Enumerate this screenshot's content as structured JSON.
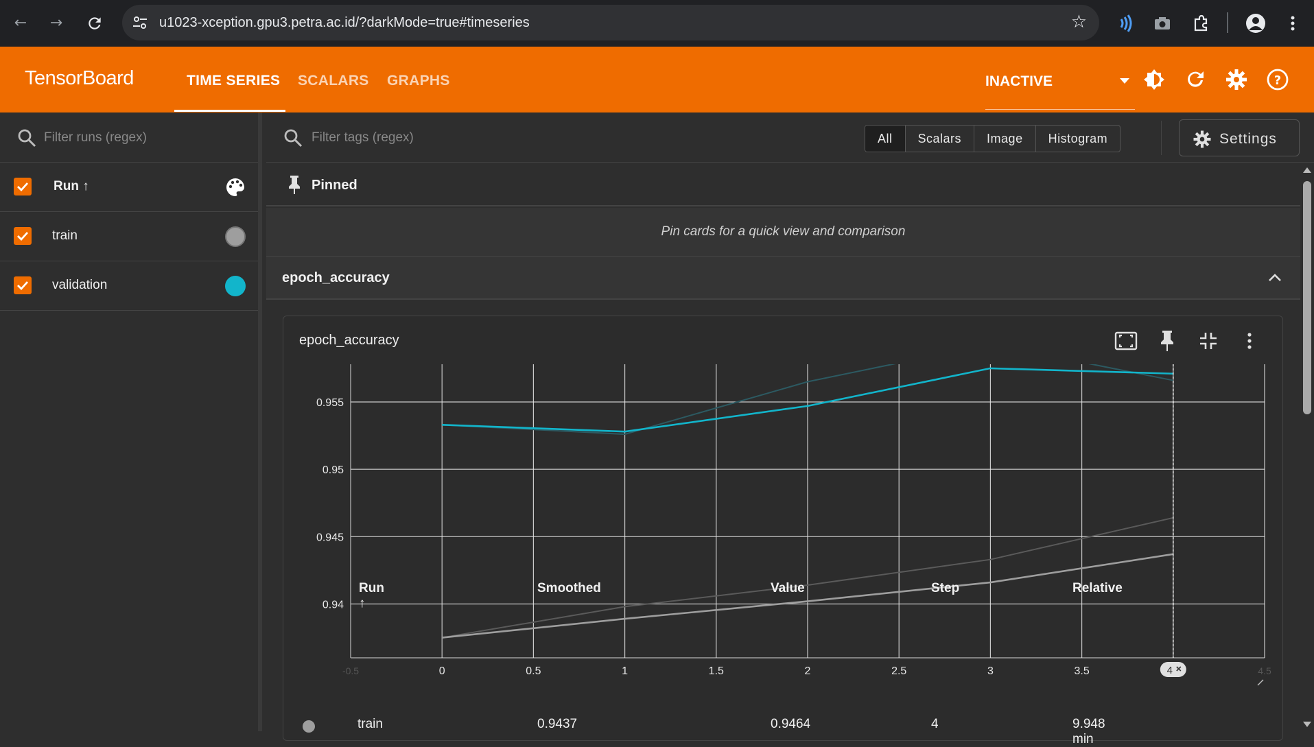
{
  "browser": {
    "url": "u1023-xception.gpu3.petra.ac.id/?darkMode=true#timeseries"
  },
  "header": {
    "brand": "TensorBoard",
    "tabs": [
      {
        "label": "TIME SERIES",
        "active": true
      },
      {
        "label": "SCALARS",
        "active": false
      },
      {
        "label": "GRAPHS",
        "active": false
      }
    ],
    "status": "INACTIVE",
    "accent_color": "#ef6c00"
  },
  "sidebar": {
    "filter_placeholder": "Filter runs (regex)",
    "header_label": "Run ↑",
    "runs": [
      {
        "name": "train",
        "color": "#9e9e9e",
        "checked": true
      },
      {
        "name": "validation",
        "color": "#12b5cb",
        "checked": true
      }
    ]
  },
  "main": {
    "filter_placeholder": "Filter tags (regex)",
    "type_filters": [
      "All",
      "Scalars",
      "Image",
      "Histogram"
    ],
    "settings_label": "Settings",
    "pinned_label": "Pinned",
    "pinned_empty": "Pin cards for a quick view and comparison",
    "group_label": "epoch_accuracy",
    "card_title": "epoch_accuracy",
    "step_marker": "4",
    "edge_tick_left": "-0.5",
    "edge_tick_right": "4.5"
  },
  "chart_data": {
    "type": "line",
    "title": "epoch_accuracy",
    "xlim": [
      -0.5,
      4.5
    ],
    "ylim": [
      0.936,
      0.9578
    ],
    "x_ticks": [
      "0",
      "0.5",
      "1",
      "1.5",
      "2",
      "2.5",
      "3",
      "3.5",
      "4"
    ],
    "y_ticks": [
      "0.955",
      "0.95",
      "0.945",
      "0.94"
    ],
    "grid": true,
    "series": [
      {
        "name": "train",
        "kind": "smoothed",
        "color": "#9e9e9e",
        "x": [
          0,
          1,
          2,
          3,
          4
        ],
        "y": [
          0.9375,
          0.9389,
          0.9402,
          0.9416,
          0.9437
        ]
      },
      {
        "name": "train",
        "kind": "raw",
        "color": "#5a5a5a",
        "x": [
          0,
          1,
          2,
          3,
          4
        ],
        "y": [
          0.9375,
          0.9398,
          0.9414,
          0.9433,
          0.9464
        ]
      },
      {
        "name": "validation",
        "kind": "smoothed",
        "color": "#12b5cb",
        "x": [
          0,
          1,
          2,
          3,
          4
        ],
        "y": [
          0.9533,
          0.9528,
          0.9547,
          0.9575,
          0.9571
        ]
      },
      {
        "name": "validation",
        "kind": "raw",
        "color": "#2c5a62",
        "x": [
          0,
          1,
          2,
          3,
          4
        ],
        "y": [
          0.9533,
          0.9526,
          0.9565,
          0.9593,
          0.9566
        ]
      }
    ]
  },
  "table": {
    "headers": [
      "Run ↑",
      "Smoothed",
      "Value",
      "Step",
      "Relative"
    ],
    "rows": [
      {
        "run": "train",
        "smoothed": "0.9437",
        "value": "0.9464",
        "step": "4",
        "relative": "9.948 min"
      }
    ]
  }
}
